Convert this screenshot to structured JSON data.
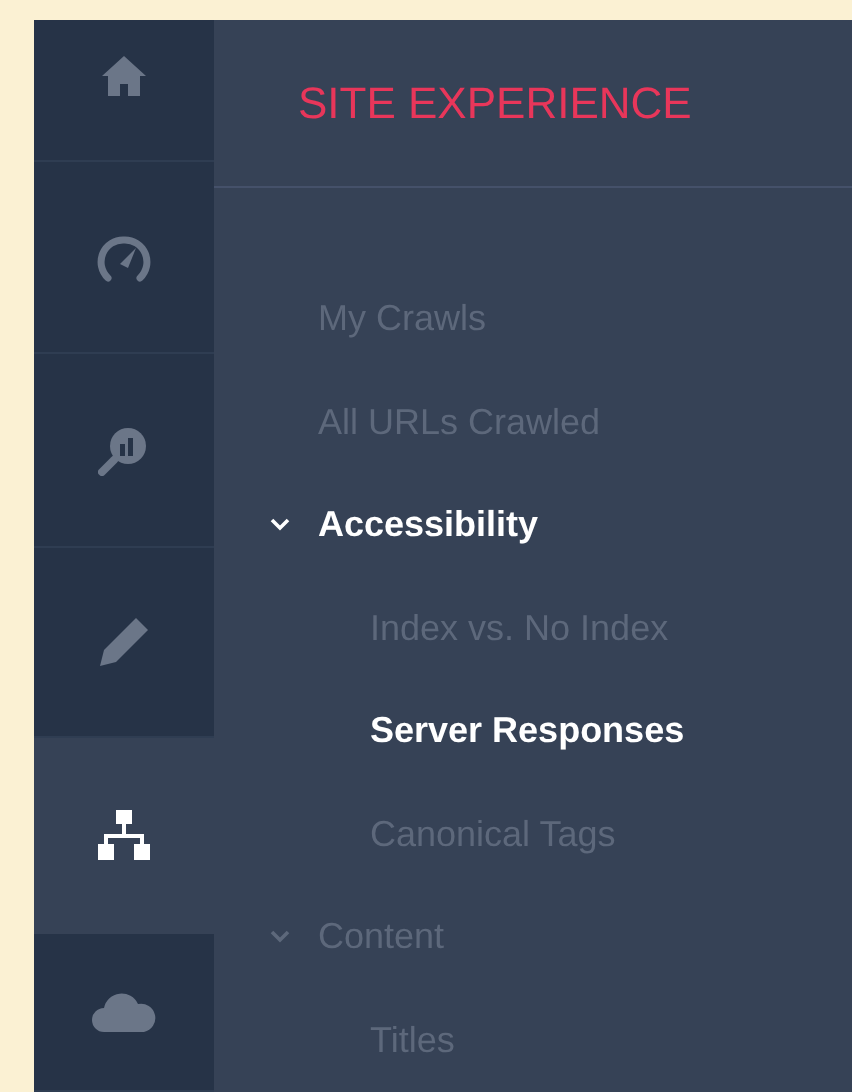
{
  "rail": [
    {
      "kind": "home",
      "selected": false
    },
    {
      "kind": "gauge",
      "selected": false
    },
    {
      "kind": "search",
      "selected": false
    },
    {
      "kind": "pencil",
      "selected": false
    },
    {
      "kind": "sitemap",
      "selected": true
    },
    {
      "kind": "cloud",
      "selected": false
    }
  ],
  "title": "SITE EXPERIENCE",
  "menu": [
    {
      "label": "My Crawls",
      "selected": false
    },
    {
      "label": "All URLs Crawled",
      "selected": false
    },
    {
      "label": "Accessibility",
      "active": true,
      "expanded": true,
      "children": [
        {
          "label": "Index vs. No Index",
          "selected": false
        },
        {
          "label": "Server Responses",
          "selected": true
        },
        {
          "label": "Canonical Tags",
          "selected": false
        }
      ]
    },
    {
      "label": "Content",
      "active": false,
      "expanded": true,
      "children": [
        {
          "label": "Titles",
          "selected": false
        }
      ]
    }
  ]
}
